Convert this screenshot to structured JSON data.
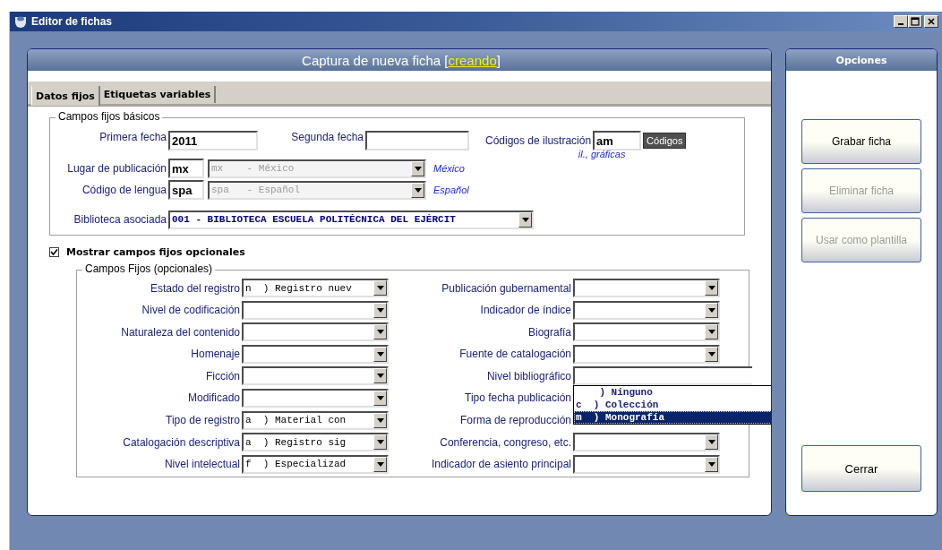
{
  "window": {
    "title": "Editor de fichas"
  },
  "header": {
    "prefix": "Captura de nueva ficha [",
    "status": "creando",
    "suffix": "]"
  },
  "tabs": [
    {
      "label": "Datos fijos",
      "selected": true
    },
    {
      "label": "Etiquetas variables",
      "selected": false
    }
  ],
  "basic": {
    "legend": "Campos fijos básicos",
    "primera_fecha": {
      "label": "Primera fecha",
      "value": "2011"
    },
    "segunda_fecha": {
      "label": "Segunda fecha"
    },
    "ilustracion": {
      "label": "Códigos de ilustración",
      "value": "am",
      "button": "Códigos",
      "hint": "il., gráficas"
    },
    "coded": [
      {
        "label": "Lugar de publicación",
        "code": "mx",
        "select": "mx    - México",
        "note": "México"
      },
      {
        "label": "Código de lengua",
        "code": "spa",
        "select": "spa   - Español",
        "note": "Español"
      }
    ],
    "biblioteca": {
      "label": "Biblioteca asociada",
      "value": "001 - BIBLIOTECA ESCUELA POLITÉCNICA DEL EJÉRCIT"
    }
  },
  "optional_toggle": {
    "label": "Mostrar campos fijos opcionales",
    "checked": true
  },
  "optional": {
    "legend": "Campos Fijos (opcionales)",
    "left": [
      {
        "label": "Estado del registro",
        "value": "n  ) Registro nuev"
      },
      {
        "label": "Nivel de codificación"
      },
      {
        "label": "Naturaleza del contenido"
      },
      {
        "label": "Homenaje"
      },
      {
        "label": "Ficción"
      },
      {
        "label": "Modificado"
      },
      {
        "label": "Tipo de registro",
        "value": "a  ) Material con"
      },
      {
        "label": "Catalogación descriptiva",
        "value": "a  ) Registro sig"
      },
      {
        "label": "Nivel intelectual",
        "value": "f  ) Especializad"
      }
    ],
    "right": [
      {
        "label": "Publicación gubernamental",
        "kind": "select"
      },
      {
        "label": "Indicador de índice",
        "kind": "select"
      },
      {
        "label": "Biografía",
        "kind": "select"
      },
      {
        "label": "Fuente de catalogación",
        "kind": "select"
      },
      {
        "label": "Nivel bibliográfico",
        "kind": "open"
      },
      {
        "label": "Tipo fecha publicación",
        "kind": "covered"
      },
      {
        "label": "Forma de reproducción",
        "kind": "covered"
      },
      {
        "label": "Conferencia, congreso, etc.",
        "kind": "select"
      },
      {
        "label": "Indicador de asiento principal",
        "kind": "select"
      }
    ],
    "open_list": [
      {
        "text": "    ) Ninguno",
        "selected": false
      },
      {
        "text": "c  ) Colección",
        "selected": false
      },
      {
        "text": "m  ) Monografía",
        "selected": true
      }
    ]
  },
  "options": {
    "title": "Opciones",
    "buttons": [
      {
        "label": "Grabar ficha",
        "disabled": false
      },
      {
        "label": "Eliminar ficha",
        "disabled": true
      },
      {
        "label": "Usar como plantilla",
        "disabled": true
      }
    ],
    "close": {
      "label": "Cerrar",
      "disabled": false
    }
  }
}
